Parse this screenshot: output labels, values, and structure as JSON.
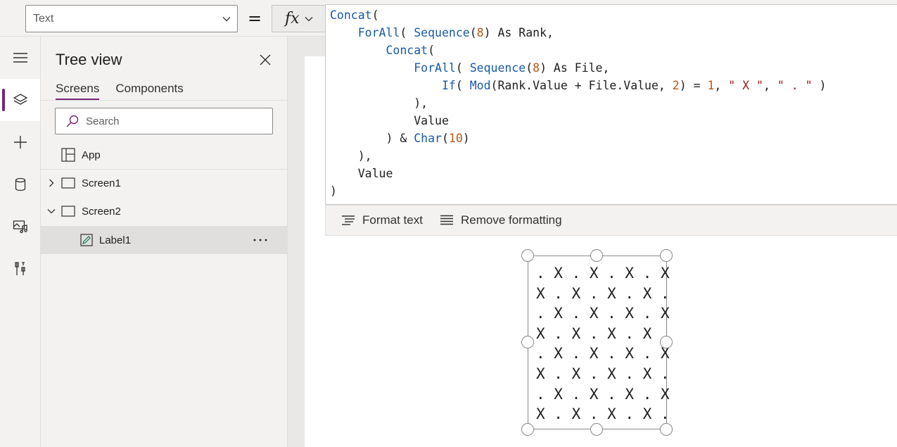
{
  "formula_bar": {
    "property_value": "Text",
    "equals": "=",
    "fx_label": "fx",
    "code_lines": [
      [
        {
          "t": "Concat",
          "c": "fn"
        },
        {
          "t": "(",
          "c": ""
        }
      ],
      [
        {
          "t": "    ",
          "c": ""
        },
        {
          "t": "ForAll",
          "c": "fn"
        },
        {
          "t": "( ",
          "c": ""
        },
        {
          "t": "Sequence",
          "c": "fn"
        },
        {
          "t": "(",
          "c": ""
        },
        {
          "t": "8",
          "c": "num"
        },
        {
          "t": ") As Rank,",
          "c": ""
        }
      ],
      [
        {
          "t": "        ",
          "c": ""
        },
        {
          "t": "Concat",
          "c": "fn"
        },
        {
          "t": "(",
          "c": ""
        }
      ],
      [
        {
          "t": "            ",
          "c": ""
        },
        {
          "t": "ForAll",
          "c": "fn"
        },
        {
          "t": "( ",
          "c": ""
        },
        {
          "t": "Sequence",
          "c": "fn"
        },
        {
          "t": "(",
          "c": ""
        },
        {
          "t": "8",
          "c": "num"
        },
        {
          "t": ") As File,",
          "c": ""
        }
      ],
      [
        {
          "t": "                ",
          "c": ""
        },
        {
          "t": "If",
          "c": "fn"
        },
        {
          "t": "( ",
          "c": ""
        },
        {
          "t": "Mod",
          "c": "fn"
        },
        {
          "t": "(Rank.Value + File.Value, ",
          "c": ""
        },
        {
          "t": "2",
          "c": "num"
        },
        {
          "t": ") = ",
          "c": ""
        },
        {
          "t": "1",
          "c": "num"
        },
        {
          "t": ", ",
          "c": ""
        },
        {
          "t": "\" X \"",
          "c": "str"
        },
        {
          "t": ", ",
          "c": ""
        },
        {
          "t": "\" . \"",
          "c": "str"
        },
        {
          "t": " )",
          "c": ""
        }
      ],
      [
        {
          "t": "            ),",
          "c": ""
        }
      ],
      [
        {
          "t": "            Value",
          "c": ""
        }
      ],
      [
        {
          "t": "        ) & ",
          "c": ""
        },
        {
          "t": "Char",
          "c": "fn"
        },
        {
          "t": "(",
          "c": ""
        },
        {
          "t": "10",
          "c": "num"
        },
        {
          "t": ")",
          "c": ""
        }
      ],
      [
        {
          "t": "    ),",
          "c": ""
        }
      ],
      [
        {
          "t": "    Value",
          "c": ""
        }
      ],
      [
        {
          "t": ")",
          "c": ""
        }
      ]
    ],
    "format_text_label": "Format text",
    "remove_formatting_label": "Remove formatting"
  },
  "tree_view": {
    "title": "Tree view",
    "tabs": [
      {
        "label": "Screens",
        "active": true
      },
      {
        "label": "Components",
        "active": false
      }
    ],
    "search_placeholder": "Search",
    "nodes": {
      "app": "App",
      "screen1": "Screen1",
      "screen2": "Screen2",
      "label1": "Label1"
    }
  },
  "canvas": {
    "board_rows": [
      ". X . X . X . X",
      "X . X . X . X .",
      ". X . X . X . X",
      "X . X . X . X .",
      ". X . X . X . X",
      "X . X . X . X .",
      ". X . X . X . X",
      "X . X . X . X ."
    ]
  },
  "colors": {
    "accent": "#742774",
    "function": "#1a5aa6",
    "number": "#b5581a",
    "string": "#a31515"
  }
}
